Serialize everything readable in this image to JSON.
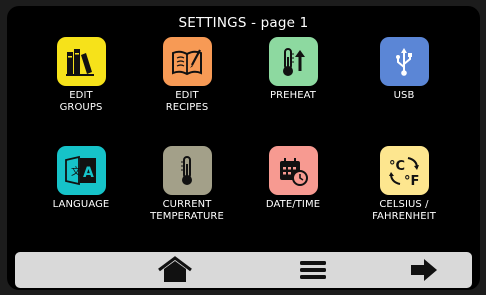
{
  "title": "SETTINGS - page 1",
  "tiles": [
    {
      "label": "EDIT\nGROUPS",
      "color": "#f6e21a",
      "icon": "books-icon"
    },
    {
      "label": "EDIT\nRECIPES",
      "color": "#f79a55",
      "icon": "recipe-book-icon"
    },
    {
      "label": "PREHEAT",
      "color": "#8dd9a0",
      "icon": "thermometer-up-icon"
    },
    {
      "label": "USB",
      "color": "#5b86d6",
      "icon": "usb-icon"
    },
    {
      "label": "LANGUAGE",
      "color": "#16c3c9",
      "icon": "language-icon"
    },
    {
      "label": "CURRENT\nTEMPERATURE",
      "color": "#a3a089",
      "icon": "thermometer-icon"
    },
    {
      "label": "DATE/TIME",
      "color": "#f79a91",
      "icon": "calendar-clock-icon"
    },
    {
      "label": "CELSIUS /\nFAHRENHEIT",
      "color": "#fde68f",
      "icon": "celsius-fahrenheit-icon"
    }
  ],
  "navbar": {
    "buttons": [
      {
        "icon": "home-icon"
      },
      {
        "icon": "menu-icon"
      },
      {
        "icon": "arrow-right-icon"
      }
    ],
    "color": "#d9d9d9"
  }
}
